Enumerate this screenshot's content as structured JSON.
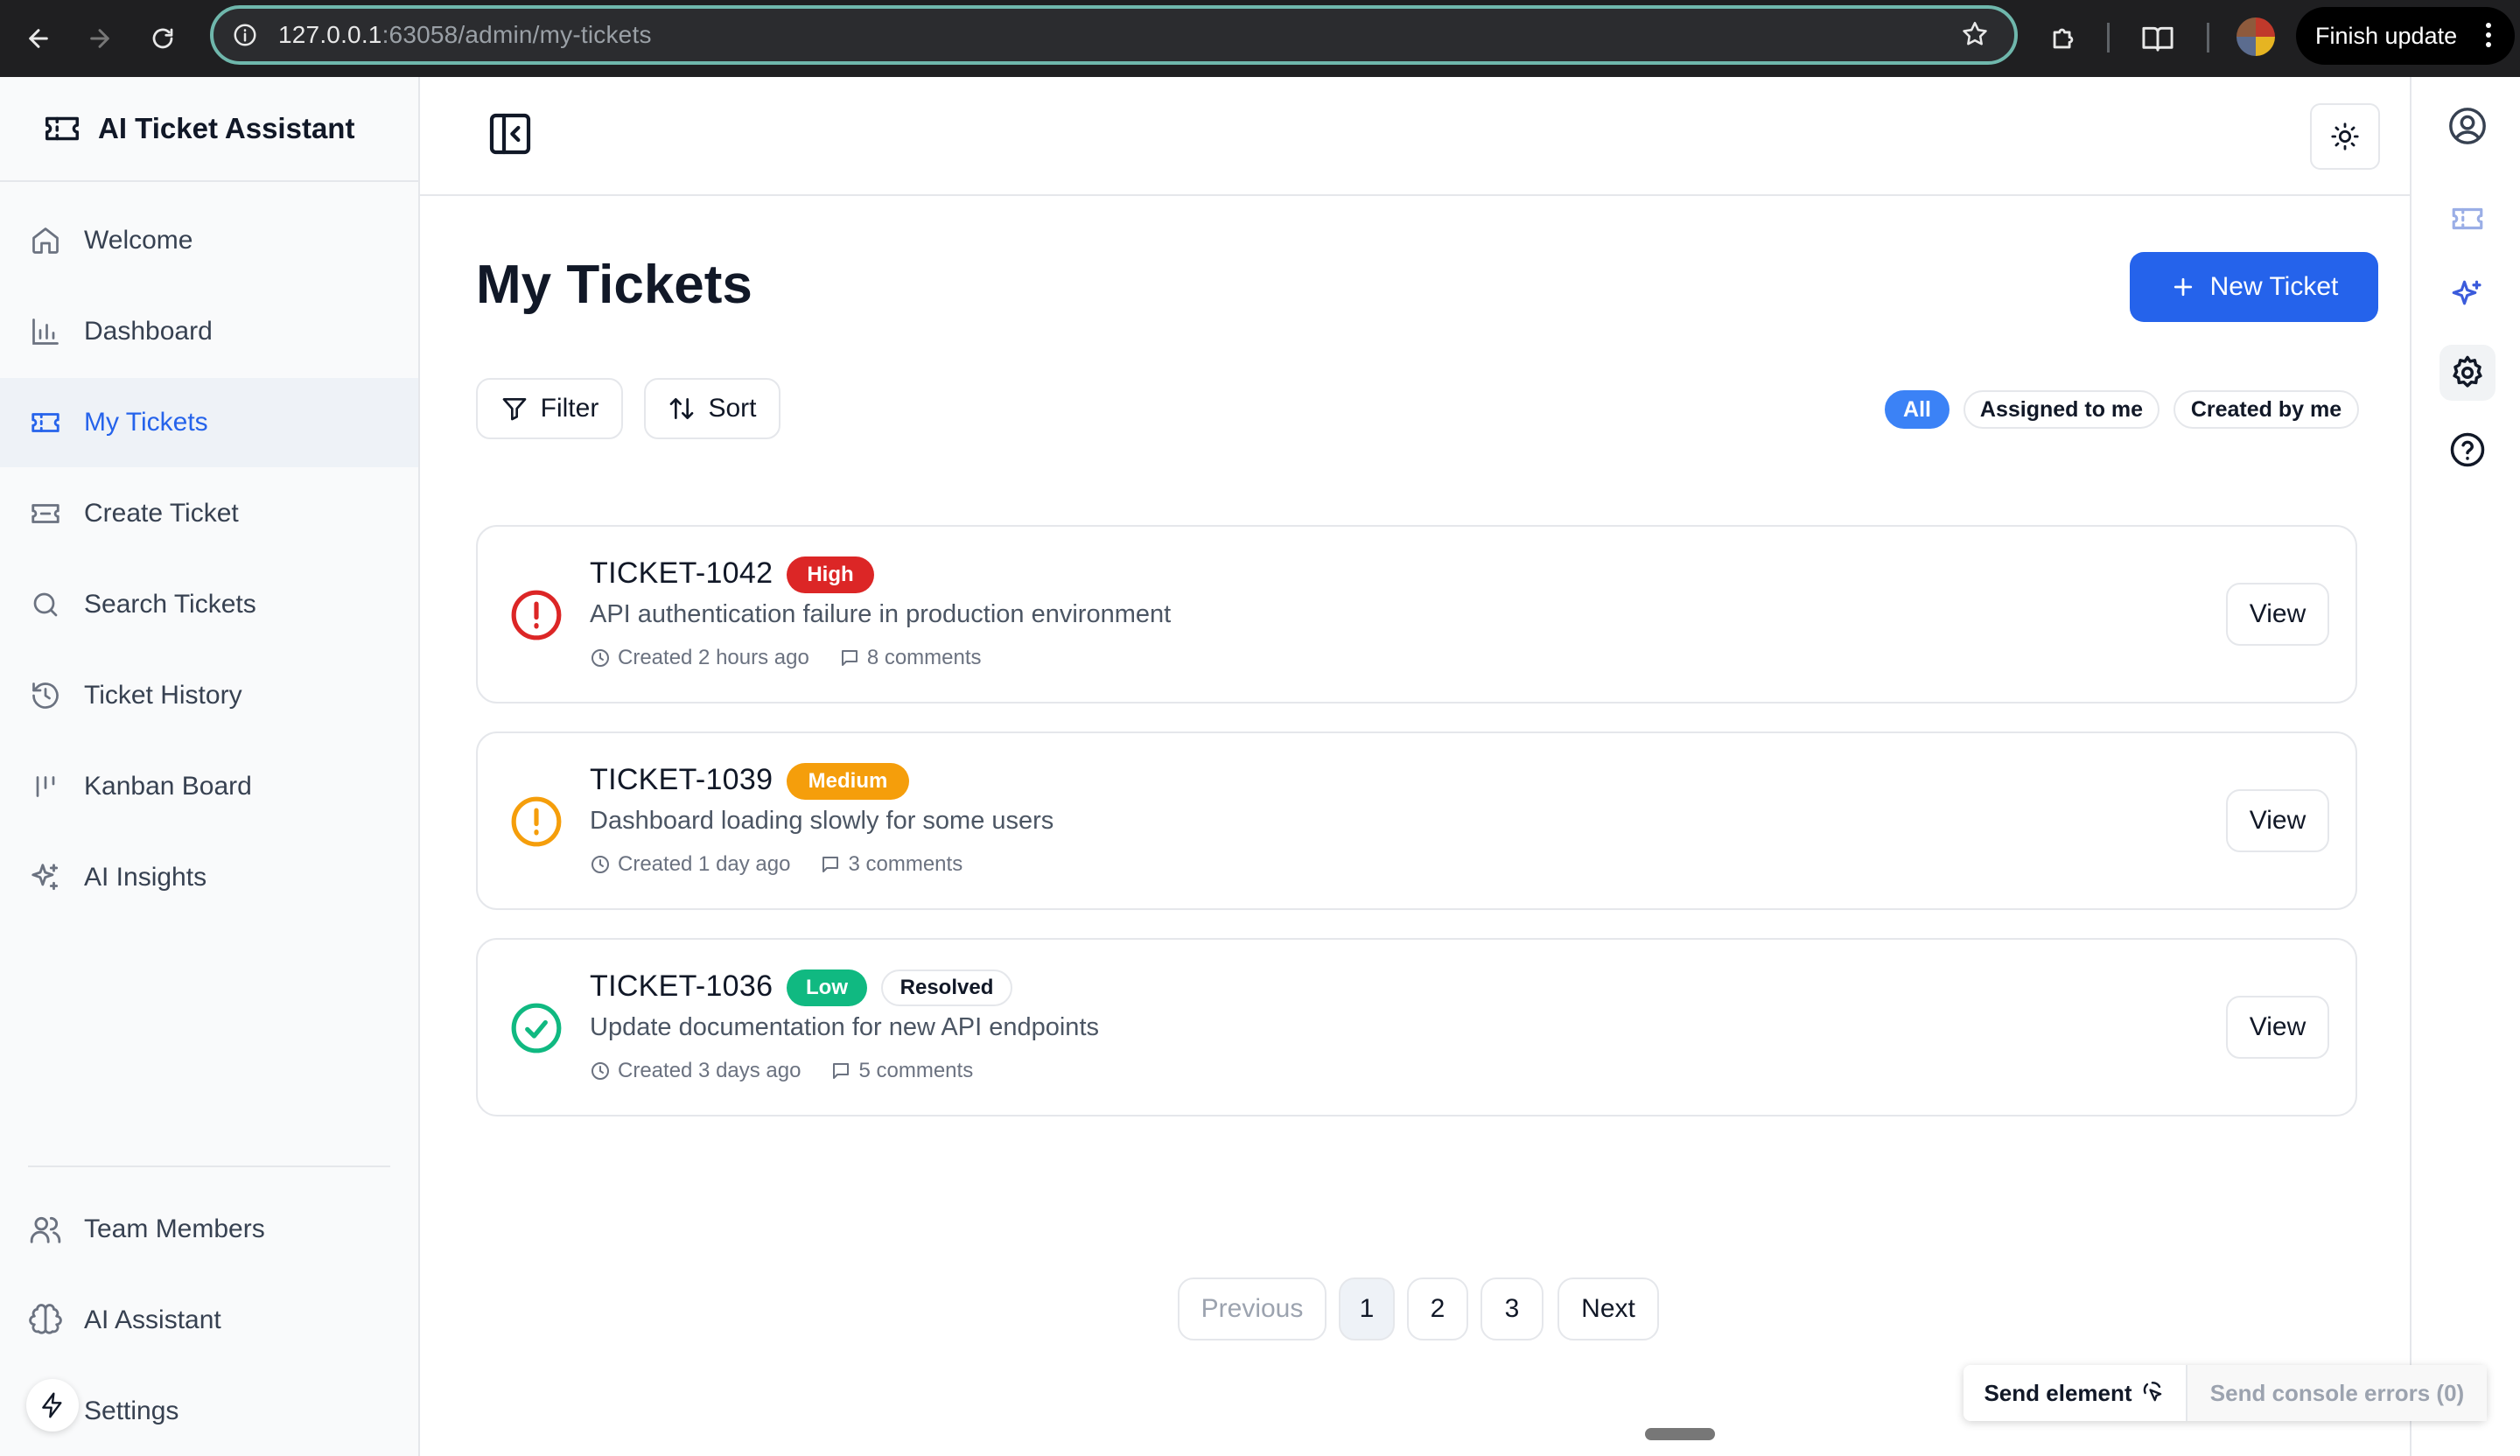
{
  "browser": {
    "url_host": "127.0.0.1",
    "url_rest": ":63058/admin/my-tickets",
    "finish_update": "Finish update"
  },
  "sidebar": {
    "brand": "AI Ticket Assistant",
    "items": [
      {
        "label": "Welcome",
        "icon": "home-icon"
      },
      {
        "label": "Dashboard",
        "icon": "bar-chart-icon"
      },
      {
        "label": "My Tickets",
        "icon": "ticket-icon",
        "active": true
      },
      {
        "label": "Create Ticket",
        "icon": "ticket-plus-icon"
      },
      {
        "label": "Search Tickets",
        "icon": "search-icon"
      },
      {
        "label": "Ticket History",
        "icon": "history-icon"
      },
      {
        "label": "Kanban Board",
        "icon": "kanban-icon"
      },
      {
        "label": "AI Insights",
        "icon": "sparkles-icon"
      }
    ],
    "bottom_items": [
      {
        "label": "Team Members",
        "icon": "users-icon"
      },
      {
        "label": "AI Assistant",
        "icon": "brain-icon"
      },
      {
        "label": "Settings",
        "icon": "settings-icon"
      }
    ]
  },
  "main": {
    "title": "My Tickets",
    "new_ticket": "New Ticket",
    "filter": "Filter",
    "sort": "Sort",
    "chips": [
      {
        "label": "All",
        "active": true
      },
      {
        "label": "Assigned to me"
      },
      {
        "label": "Created by me"
      }
    ],
    "tickets": [
      {
        "id": "TICKET-1042",
        "priority": "High",
        "priority_color": "#dc2626",
        "status": "",
        "description": "API authentication failure in production environment",
        "created": "Created 2 hours ago",
        "comments": "8 comments",
        "icon": "alert-circle-icon",
        "icon_color": "#dc2626",
        "view": "View"
      },
      {
        "id": "TICKET-1039",
        "priority": "Medium",
        "priority_color": "#f59e0b",
        "status": "",
        "description": "Dashboard loading slowly for some users",
        "created": "Created 1 day ago",
        "comments": "3 comments",
        "icon": "alert-circle-icon",
        "icon_color": "#f59e0b",
        "view": "View"
      },
      {
        "id": "TICKET-1036",
        "priority": "Low",
        "priority_color": "#10b981",
        "status": "Resolved",
        "description": "Update documentation for new API endpoints",
        "created": "Created 3 days ago",
        "comments": "5 comments",
        "icon": "check-circle-icon",
        "icon_color": "#10b981",
        "view": "View"
      }
    ],
    "pagination": {
      "previous": "Previous",
      "pages": [
        "1",
        "2",
        "3"
      ],
      "current": "1",
      "next": "Next"
    }
  },
  "devtools": {
    "send_element": "Send element",
    "send_console_errors": "Send console errors (0)"
  },
  "colors": {
    "accent": "#2563eb",
    "high": "#dc2626",
    "medium": "#f59e0b",
    "low": "#10b981"
  }
}
